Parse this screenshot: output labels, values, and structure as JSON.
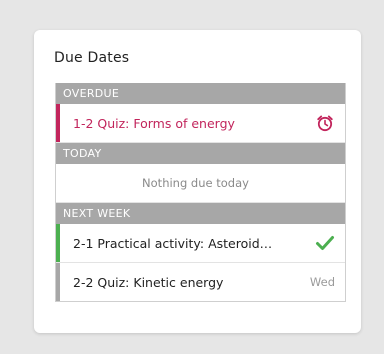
{
  "card": {
    "title": "Due Dates"
  },
  "colors": {
    "overdue": "#c2255c",
    "complete": "#4caf50",
    "header_bg": "#a7a7a7",
    "neutral_accent": "#a7a7a7"
  },
  "sections": {
    "overdue": {
      "label": "OVERDUE",
      "items": [
        {
          "title": "1-2  Quiz: Forms of energy",
          "icon": "alarm-clock-icon"
        }
      ]
    },
    "today": {
      "label": "TODAY",
      "empty_text": "Nothing due today"
    },
    "next_week": {
      "label": "NEXT WEEK",
      "items": [
        {
          "title": "2-1  Practical activity: Asteroid…",
          "icon": "checkmark-icon"
        },
        {
          "title": "2-2  Quiz: Kinetic energy",
          "day": "Wed"
        }
      ]
    }
  }
}
